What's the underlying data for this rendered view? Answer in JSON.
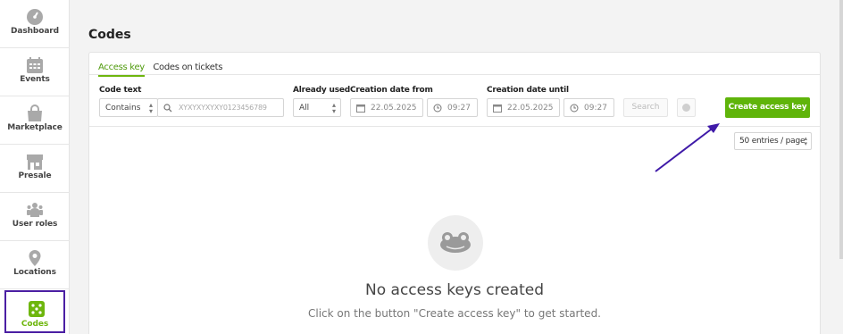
{
  "sidebar": {
    "items": [
      {
        "label": "Dashboard",
        "icon": "dashboard-icon"
      },
      {
        "label": "Events",
        "icon": "calendar-icon"
      },
      {
        "label": "Marketplace",
        "icon": "shopping-bag-icon"
      },
      {
        "label": "Presale",
        "icon": "store-icon"
      },
      {
        "label": "User roles",
        "icon": "users-icon"
      },
      {
        "label": "Locations",
        "icon": "location-pin-icon"
      },
      {
        "label": "Codes",
        "icon": "dice-icon",
        "active": true
      }
    ]
  },
  "page": {
    "title": "Codes"
  },
  "tabs": [
    {
      "label": "Access key",
      "active": true
    },
    {
      "label": "Codes on tickets",
      "active": false
    }
  ],
  "filters": {
    "code_text_label": "Code text",
    "code_text_operator": "Contains",
    "code_text_placeholder": "XYXYXYXYXY0123456789",
    "already_used_label": "Already used",
    "already_used_value": "All",
    "creation_from_label": "Creation date from",
    "creation_from_date": "22.05.2025",
    "creation_from_time": "09:27",
    "creation_until_label": "Creation date until",
    "creation_until_date": "22.05.2025",
    "creation_until_time": "09:27",
    "search_label": "Search",
    "create_label": "Create access key"
  },
  "pagination": {
    "entries_label": "50 entries / page"
  },
  "empty_state": {
    "title": "No access keys created",
    "subtitle": "Click on the button \"Create access key\" to get started."
  },
  "colors": {
    "accent_green": "#5fb40a",
    "highlight_purple": "#4b1fa3",
    "icon_gray": "#a9a9a9"
  }
}
